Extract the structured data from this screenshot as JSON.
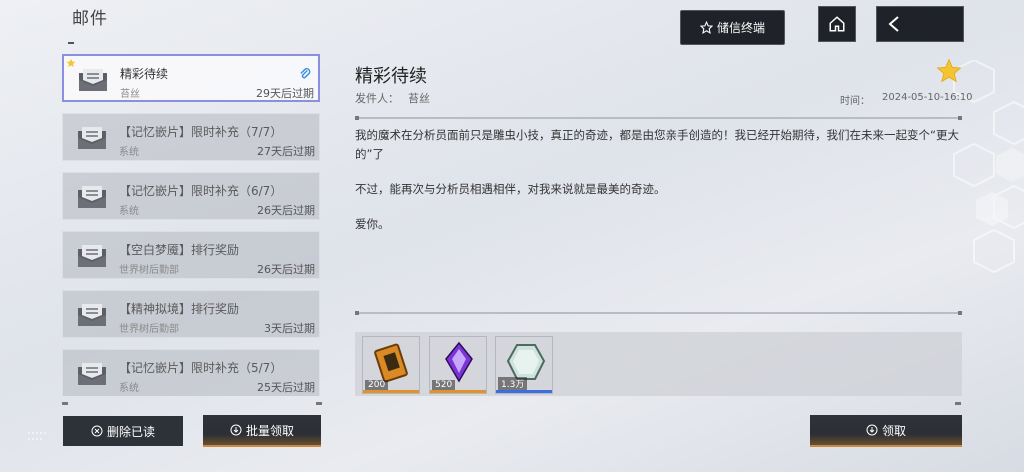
{
  "header": {
    "title": "邮件",
    "storage_label": "储信终端"
  },
  "mail_list": [
    {
      "title": "精彩待续",
      "sender": "苔丝",
      "expire": "29天后过期",
      "selected": true,
      "has_attachment": true,
      "starred": true
    },
    {
      "title": "【记忆嵌片】限时补充（7/7）",
      "sender": "系统",
      "expire": "27天后过期"
    },
    {
      "title": "【记忆嵌片】限时补充（6/7）",
      "sender": "系统",
      "expire": "26天后过期"
    },
    {
      "title": "【空白梦魇】排行奖励",
      "sender": "世界树后勤部",
      "expire": "26天后过期"
    },
    {
      "title": "【精神拟境】排行奖励",
      "sender": "世界树后勤部",
      "expire": "3天后过期"
    },
    {
      "title": "【记忆嵌片】限时补充（5/7）",
      "sender": "系统",
      "expire": "25天后过期"
    }
  ],
  "buttons": {
    "delete_read": "删除已读",
    "batch_claim": "批量领取",
    "claim": "领取"
  },
  "detail": {
    "title": "精彩待续",
    "sender_label": "发件人：",
    "sender": "苔丝",
    "time_label": "时间：",
    "time": "2024-05-10-16:10",
    "body": [
      "我的魔术在分析员面前只是雕虫小技，真正的奇迹，都是由您亲手创造的！我已经开始期待，我们在未来一起变个“更大的”了",
      "不过，能再次与分析员相遇相伴，对我来说就是最美的奇迹。",
      "爱你。"
    ]
  },
  "rewards": [
    {
      "qty": "200",
      "icon": "ticket-card-icon",
      "bar_color": "#e0922f"
    },
    {
      "qty": "520",
      "icon": "purple-crystal-icon",
      "bar_color": "#e0922f"
    },
    {
      "qty": "1.3万",
      "icon": "hexagon-stone-icon",
      "bar_color": "#3d6de0"
    }
  ],
  "colors": {
    "selected_border": "#8a8fe0",
    "gold_accent": "#c98a45",
    "star": "#f4c431"
  }
}
